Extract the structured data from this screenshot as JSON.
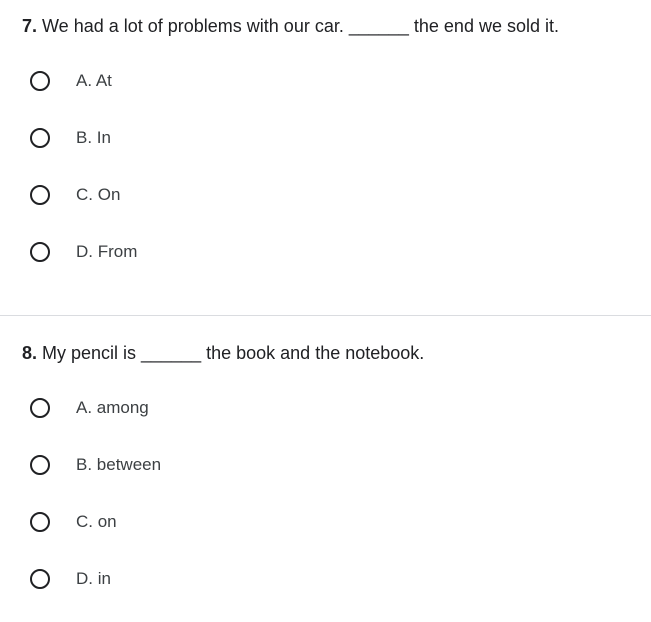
{
  "questions": [
    {
      "number": "7.",
      "text": " We had a lot of problems with our car. ______ the end we sold it.",
      "options": [
        "A. At",
        "B. In",
        "C. On",
        "D. From"
      ]
    },
    {
      "number": "8.",
      "text": " My pencil is ______ the book and the notebook.",
      "options": [
        "A. among",
        "B. between",
        "C. on",
        "D. in"
      ]
    }
  ]
}
